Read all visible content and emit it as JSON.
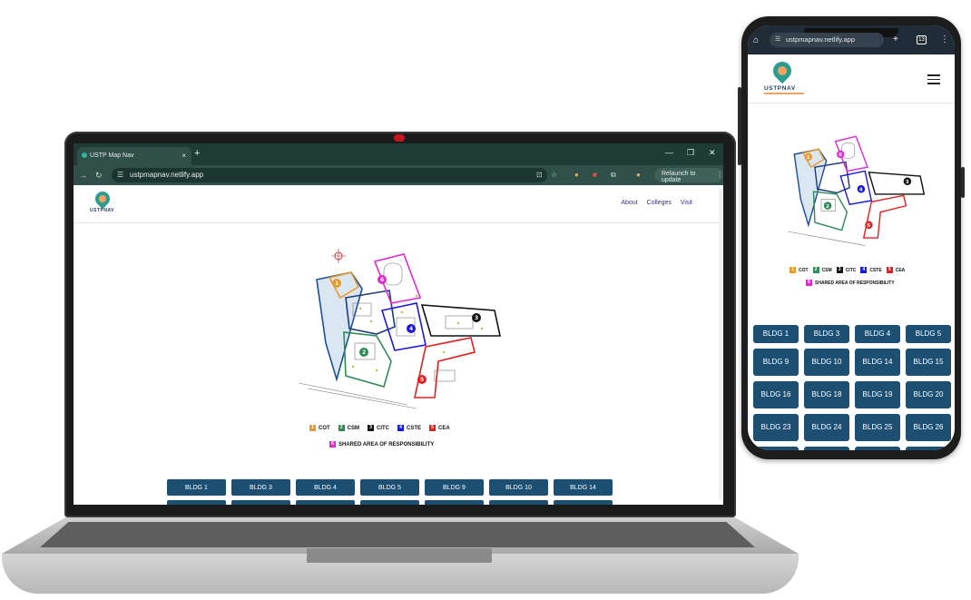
{
  "laptop": {
    "browser": {
      "tab_title": "USTP Map Nav",
      "tab_close": "×",
      "new_tab": "+",
      "url": "ustpmapnav.netlify.app",
      "relaunch_label": "Relaunch to update"
    },
    "site": {
      "logo_text": "USTPNAV",
      "nav": [
        "About",
        "Colleges",
        "Visit"
      ],
      "legend": [
        {
          "num": "1",
          "label": "COT",
          "color": "#e89a2c"
        },
        {
          "num": "2",
          "label": "CSM",
          "color": "#2e8b57"
        },
        {
          "num": "3",
          "label": "CITC",
          "color": "#111111"
        },
        {
          "num": "4",
          "label": "CSTE",
          "color": "#1a1ad6"
        },
        {
          "num": "5",
          "label": "CEA",
          "color": "#e02020"
        }
      ],
      "legend_shared": {
        "num": "6",
        "label": "SHARED AREA OF RESPONSIBILITY",
        "color": "#e02ad0"
      },
      "buildings": [
        "BLDG 1",
        "BLDG 3",
        "BLDG 4",
        "BLDG 5",
        "BLDG 9",
        "BLDG 10",
        "BLDG 14"
      ]
    }
  },
  "phone": {
    "browser": {
      "url": "ustpmapnav.netlify.app",
      "tab_count": "13"
    },
    "site": {
      "logo_text": "USTPNAV",
      "legend": [
        {
          "num": "1",
          "label": "COT",
          "color": "#e89a2c"
        },
        {
          "num": "2",
          "label": "CSM",
          "color": "#2e8b57"
        },
        {
          "num": "3",
          "label": "CITC",
          "color": "#111111"
        },
        {
          "num": "4",
          "label": "CSTE",
          "color": "#1a1ad6"
        },
        {
          "num": "5",
          "label": "CEA",
          "color": "#e02020"
        }
      ],
      "legend_shared": {
        "num": "6",
        "label": "SHARED AREA OF RESPONSIBILITY",
        "color": "#e02ad0"
      },
      "buildings": [
        "BLDG 1",
        "BLDG 3",
        "BLDG 4",
        "BLDG 5",
        "BLDG 9",
        "BLDG 10",
        "BLDG 14",
        "BLDG 15",
        "BLDG 16",
        "BLDG 18",
        "BLDG 19",
        "BLDG 20",
        "BLDG 23",
        "BLDG 24",
        "BLDG 25",
        "BLDG 26"
      ]
    }
  },
  "icons": [
    "arrow-right-icon",
    "reload-icon",
    "tune-icon",
    "install-icon",
    "star-icon",
    "extension-icon",
    "profile-icon",
    "home-icon",
    "plus-icon",
    "tabs-icon",
    "more-icon",
    "menu-icon",
    "map-pin-icon"
  ]
}
